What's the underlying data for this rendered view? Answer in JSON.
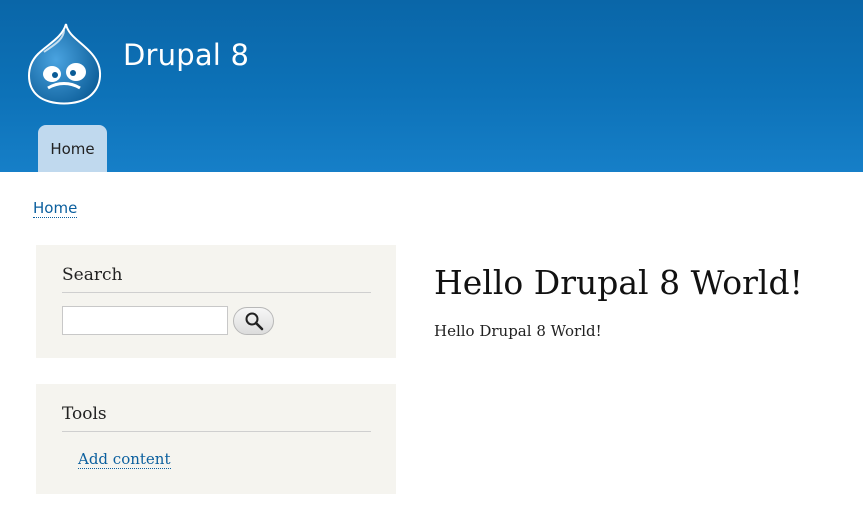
{
  "header": {
    "site_name": "Drupal 8",
    "logo_icon": "drupal-drop-logo-icon",
    "nav": [
      {
        "label": "Home",
        "active": true
      }
    ]
  },
  "breadcrumb": {
    "items": [
      "Home"
    ]
  },
  "sidebar": {
    "search_block": {
      "title": "Search",
      "input_value": "",
      "button_icon": "magnifier-icon"
    },
    "tools_block": {
      "title": "Tools",
      "links": [
        "Add content"
      ]
    }
  },
  "main": {
    "title": "Hello Drupal 8 World!",
    "body": "Hello Drupal 8 World!"
  },
  "colors": {
    "header_blue": "#0d72b8",
    "tab_active": "#c0d9ee",
    "link": "#0b5f9e",
    "sidebar_bg": "#f5f4ef"
  }
}
